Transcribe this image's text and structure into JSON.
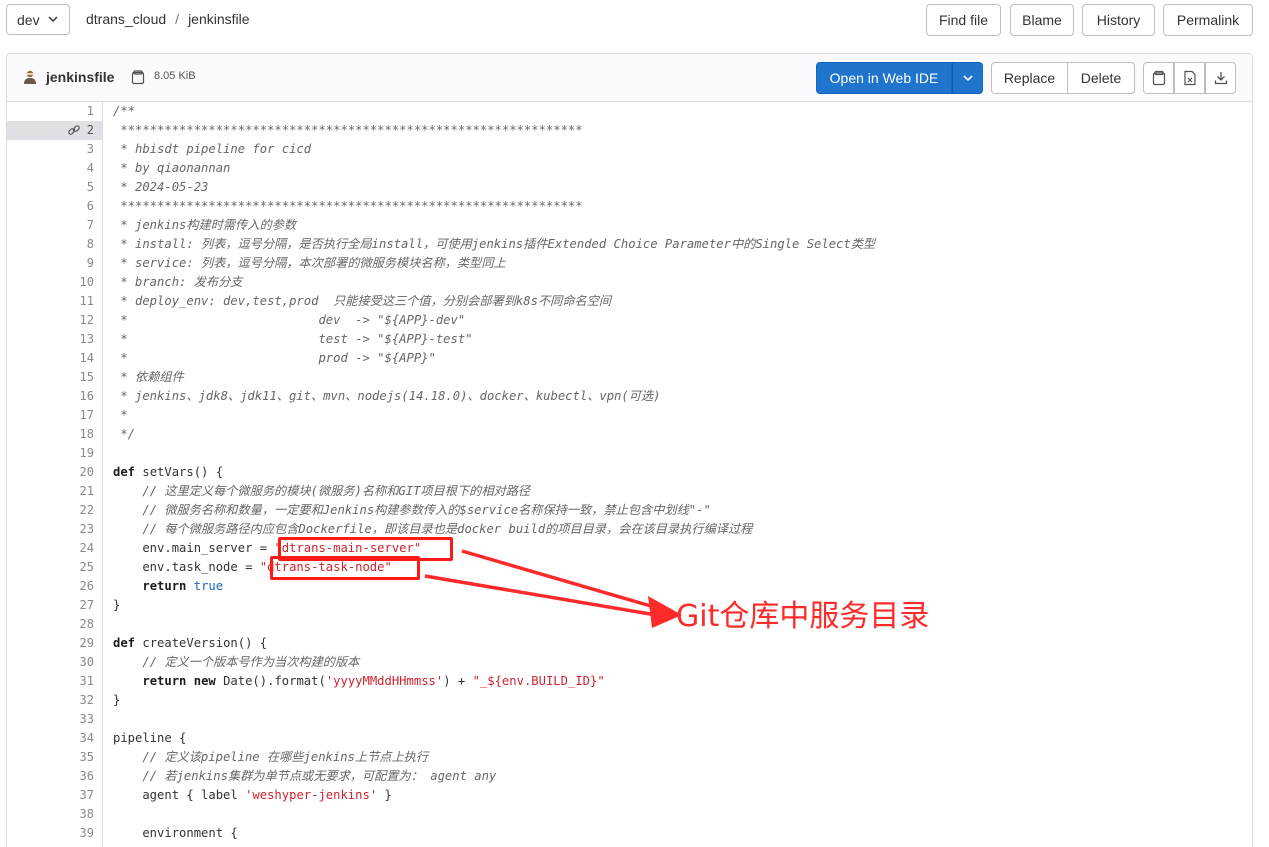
{
  "nav": {
    "branch": "dev",
    "breadcrumb": [
      "dtrans_cloud",
      "jenkinsfile"
    ],
    "breadcrumb_sep": "/",
    "buttons": [
      "Find file",
      "Blame",
      "History",
      "Permalink"
    ]
  },
  "file": {
    "name": "jenkinsfile",
    "size": "8.05 KiB",
    "open_ide_label": "Open in Web IDE",
    "replace_label": "Replace",
    "delete_label": "Delete"
  },
  "highlighted_line": 2,
  "code_lines": [
    [
      [
        "c",
        "/**"
      ]
    ],
    [
      [
        "c",
        " ***************************************************************"
      ]
    ],
    [
      [
        "c",
        " * hbisdt pipeline for cicd"
      ]
    ],
    [
      [
        "c",
        " * by qiaonannan"
      ]
    ],
    [
      [
        "c",
        " * 2024-05-23"
      ]
    ],
    [
      [
        "c",
        " ***************************************************************"
      ]
    ],
    [
      [
        "c",
        " * jenkins构建时需传入的参数"
      ]
    ],
    [
      [
        "c",
        " * install: 列表，逗号分隔，是否执行全局install，可使用jenkins插件Extended Choice Parameter中的Single Select类型"
      ]
    ],
    [
      [
        "c",
        " * service: 列表，逗号分隔，本次部署的微服务模块名称，类型同上"
      ]
    ],
    [
      [
        "c",
        " * branch: 发布分支"
      ]
    ],
    [
      [
        "c",
        " * deploy_env: dev,test,prod  只能接受这三个值，分别会部署到k8s不同命名空间"
      ]
    ],
    [
      [
        "c",
        " *                          dev  -> \"${APP}-dev\""
      ]
    ],
    [
      [
        "c",
        " *                          test -> \"${APP}-test\""
      ]
    ],
    [
      [
        "c",
        " *                          prod -> \"${APP}\""
      ]
    ],
    [
      [
        "c",
        " * 依赖组件"
      ]
    ],
    [
      [
        "c",
        " * jenkins、jdk8、jdk11、git、mvn、nodejs(14.18.0)、docker、kubectl、vpn(可选)"
      ]
    ],
    [
      [
        "c",
        " *"
      ]
    ],
    [
      [
        "c",
        " */"
      ]
    ],
    [],
    [
      [
        "k",
        "def"
      ],
      [
        "p",
        " setVars() {"
      ]
    ],
    [
      [
        "p",
        "    "
      ],
      [
        "c",
        "// 这里定义每个微服务的模块(微服务)名称和GIT项目根下的相对路径"
      ]
    ],
    [
      [
        "p",
        "    "
      ],
      [
        "c",
        "// 微服务名称和数量，一定要和Jenkins构建参数传入的$service名称保持一致，禁止包含中划线\"-\""
      ]
    ],
    [
      [
        "p",
        "    "
      ],
      [
        "c",
        "// 每个微服务路径内应包含Dockerfile，即该目录也是docker build的项目目录，会在该目录执行编译过程"
      ]
    ],
    [
      [
        "p",
        "    env.main_server = "
      ],
      [
        "s",
        "\"dtrans-main-server\""
      ]
    ],
    [
      [
        "p",
        "    env.task_node = "
      ],
      [
        "s",
        "\"dtrans-task-node\""
      ]
    ],
    [
      [
        "p",
        "    "
      ],
      [
        "k",
        "return"
      ],
      [
        "p",
        " "
      ],
      [
        "b",
        "true"
      ]
    ],
    [
      [
        "p",
        "}"
      ]
    ],
    [],
    [
      [
        "k",
        "def"
      ],
      [
        "p",
        " createVersion() {"
      ]
    ],
    [
      [
        "p",
        "    "
      ],
      [
        "c",
        "// 定义一个版本号作为当次构建的版本"
      ]
    ],
    [
      [
        "p",
        "    "
      ],
      [
        "k",
        "return"
      ],
      [
        "p",
        " "
      ],
      [
        "k",
        "new"
      ],
      [
        "p",
        " Date().format("
      ],
      [
        "s",
        "'yyyyMMddHHmmss'"
      ],
      [
        "p",
        ") + "
      ],
      [
        "s",
        "\"_${env.BUILD_ID}\""
      ]
    ],
    [
      [
        "p",
        "}"
      ]
    ],
    [],
    [
      [
        "p",
        "pipeline {"
      ]
    ],
    [
      [
        "p",
        "    "
      ],
      [
        "c",
        "// 定义该pipeline 在哪些jenkins上节点上执行"
      ]
    ],
    [
      [
        "p",
        "    "
      ],
      [
        "c",
        "// 若jenkins集群为单节点或无要求，可配置为： agent any"
      ]
    ],
    [
      [
        "p",
        "    agent { label "
      ],
      [
        "s",
        "'weshyper-jenkins'"
      ],
      [
        "p",
        " }"
      ]
    ],
    [],
    [
      [
        "p",
        "    environment {"
      ]
    ]
  ],
  "annotation": {
    "text": "Git仓库中服务目录",
    "color": "#ff2a2a"
  },
  "colors": {
    "primary": "#1f75cb",
    "comment": "#666666",
    "string": "#d0232e",
    "boolean": "#1d63c7",
    "highlight_line": "#e1e1e5"
  },
  "icons": [
    "chevron-down-icon",
    "file-icon",
    "copy-icon",
    "link-icon",
    "copy-contents-icon",
    "open-raw-icon",
    "download-icon"
  ]
}
